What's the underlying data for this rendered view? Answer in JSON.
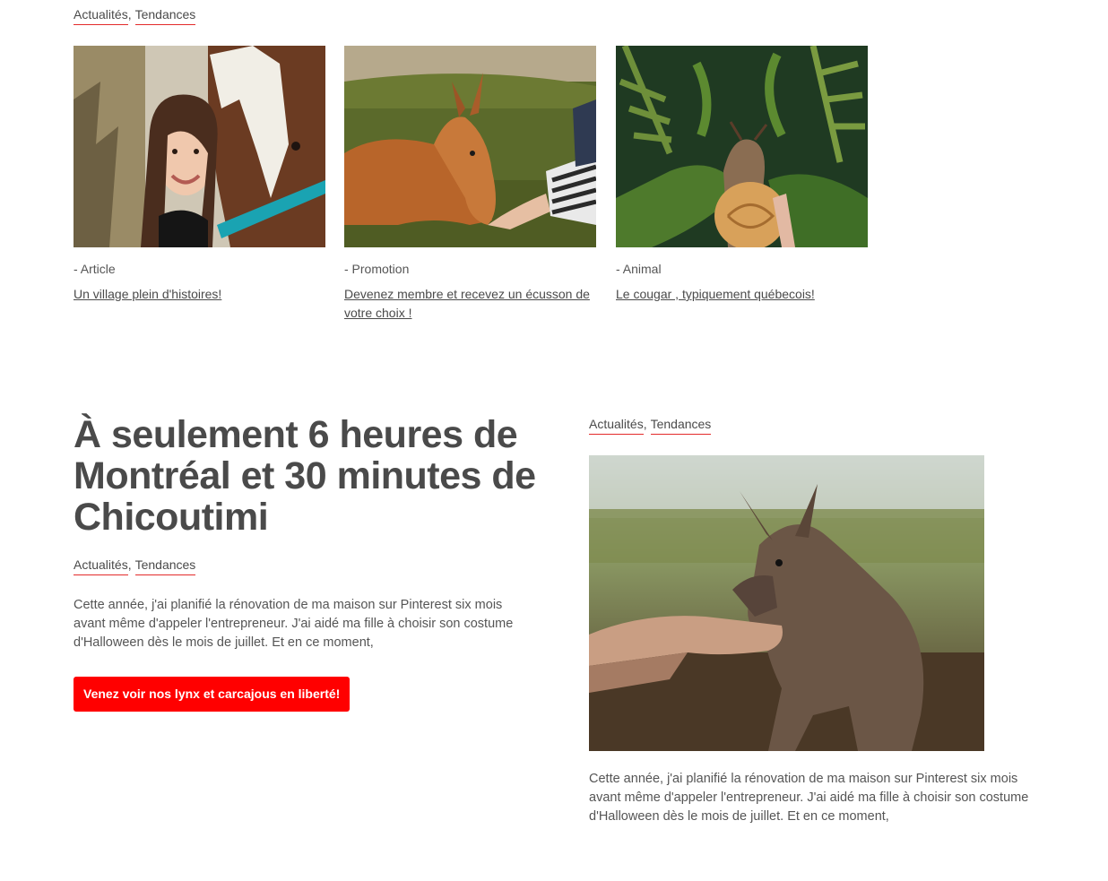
{
  "top_tags": [
    "Actualités",
    "Tendances"
  ],
  "cards": [
    {
      "category": "- Article",
      "title": "Un village plein d'histoires!",
      "image_icon": "girl-with-horse-photo"
    },
    {
      "category": "- Promotion",
      "title": "Devenez membre et recevez un écusson de votre choix !",
      "image_icon": "kangaroo-feeding-photo"
    },
    {
      "category": "- Animal",
      "title": "Le cougar , typiquement québecois!",
      "image_icon": "snail-on-fern-photo"
    }
  ],
  "feature": {
    "headline": "À seulement 6 heures de Montréal et 30 minutes de Chicoutimi",
    "tags": [
      "Actualités",
      "Tendances"
    ],
    "body": "Cette année, j'ai planifié la rénovation de ma maison sur Pinterest six mois avant même d'appeler l'entrepreneur. J'ai aidé ma fille à choisir son costume d'Halloween dès le mois de juillet. Et en ce moment,",
    "cta_label": "Venez voir nos lynx et carcajous en liberté!"
  },
  "side": {
    "tags": [
      "Actualités",
      "Tendances"
    ],
    "image_icon": "wallaby-feeding-photo",
    "body": "Cette année, j'ai planifié la rénovation de ma maison sur Pinterest six mois avant même d'appeler l'entrepreneur. J'ai aidé ma fille à choisir son costume d'Halloween dès le mois de juillet. Et en ce moment,"
  },
  "colors": {
    "accent": "#ff0000",
    "tag_underline": "#e32b2b",
    "text": "#4a4a4a"
  }
}
